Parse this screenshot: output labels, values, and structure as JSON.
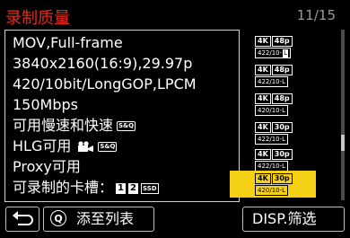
{
  "header": {
    "title": "录制质量",
    "page_indicator": "11/15"
  },
  "scroll": {
    "position_fraction": 0.68
  },
  "detail": {
    "line1": "MOV,Full-frame",
    "line2": "3840x2160(16:9),29.97p",
    "line3": "420/10bit/LongGOP,LPCM",
    "line4": "150Mbps",
    "line5": "可用慢速和快速",
    "line5_badge": "S&Q",
    "line6": "HLG可用",
    "line6_badge": "S&Q",
    "line7": "Proxy可用",
    "line8": "可录制的卡槽：",
    "slot1": "1",
    "slot2": "2",
    "ssd": "SSD"
  },
  "formats": [
    {
      "res": "4K",
      "rate": "48p",
      "codec": "422/10-",
      "mark": "L",
      "selected": false
    },
    {
      "res": "4K",
      "rate": "48p",
      "codec": "422/10-L",
      "selected": false
    },
    {
      "res": "4K",
      "rate": "48p",
      "codec": "420/10-L",
      "selected": false
    },
    {
      "res": "4K",
      "rate": "30p",
      "codec": "422/10-L",
      "selected": false
    },
    {
      "res": "4K",
      "rate": "30p",
      "codec": "422/10-L",
      "selected": false
    },
    {
      "res": "4K",
      "rate": "30p",
      "codec": "420/10-L",
      "selected": true
    }
  ],
  "footer": {
    "back_icon": "return-arrow-icon",
    "q_label": "Q",
    "add_label": "添至列表",
    "filter_label": "DISP.筛选"
  }
}
